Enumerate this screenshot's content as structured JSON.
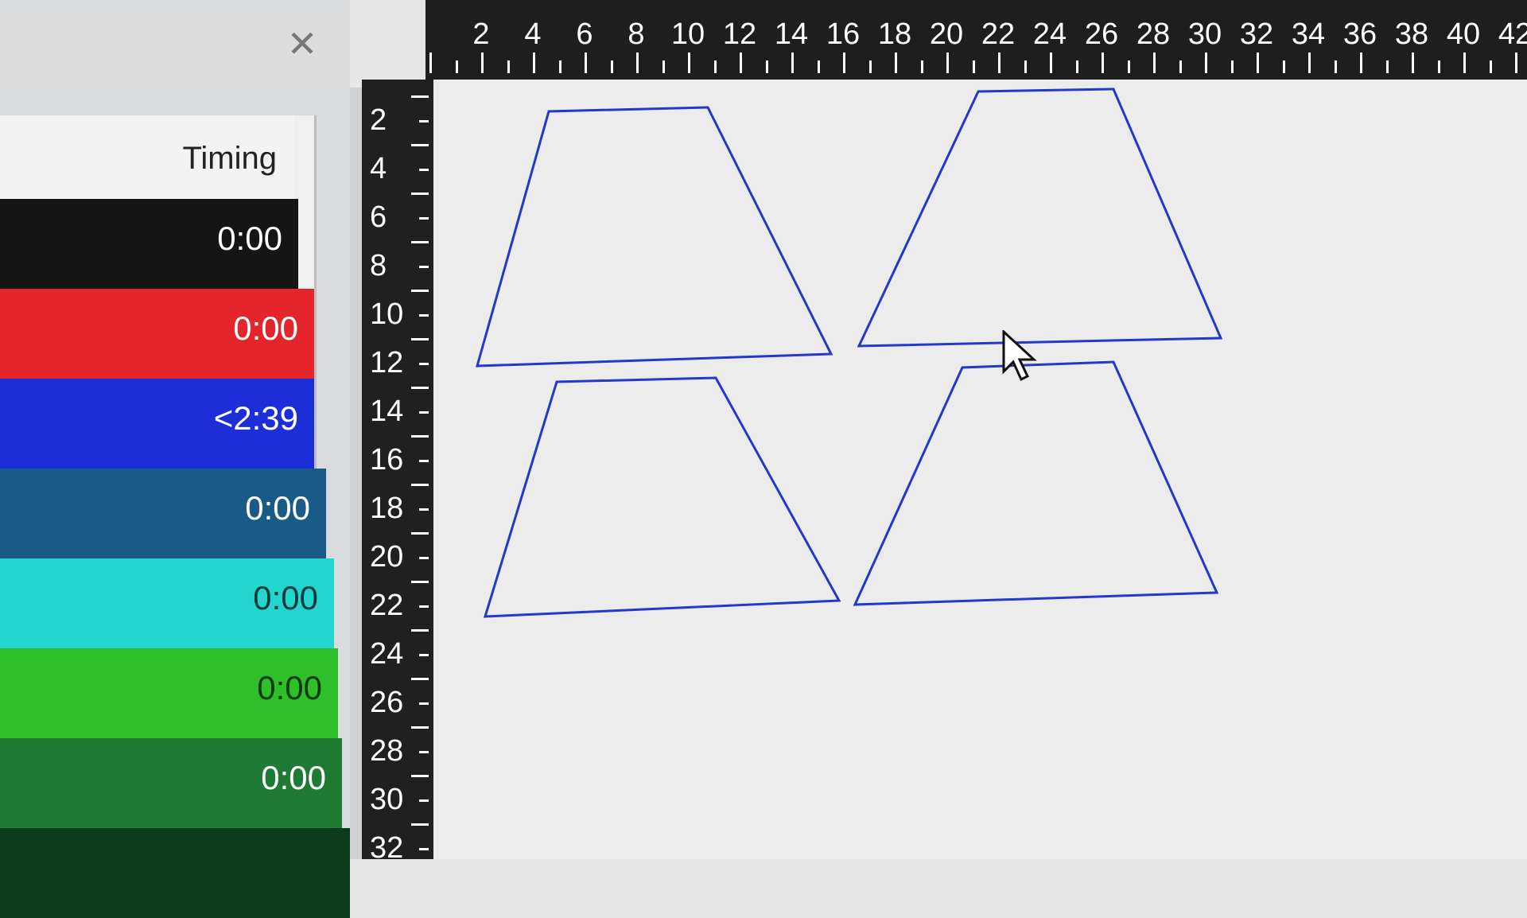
{
  "panel": {
    "close_icon": "close-icon",
    "timing_header": "Timing",
    "rows": [
      {
        "time": "0:00",
        "color": "#151515",
        "text_color": "#ffffff"
      },
      {
        "time": "0:00",
        "color": "#e4252b",
        "text_color": "#ffffff"
      },
      {
        "time": "<2:39",
        "color": "#1c2ed8",
        "text_color": "#ffffff"
      },
      {
        "time": "0:00",
        "color": "#1a5a86",
        "text_color": "#ffffff"
      },
      {
        "time": "0:00",
        "color": "#22d6cf",
        "text_color": "#0a3a3a"
      },
      {
        "time": "0:00",
        "color": "#2fbf2a",
        "text_color": "#0b3a0b"
      },
      {
        "time": "0:00",
        "color": "#1f7a33",
        "text_color": "#ffffff"
      },
      {
        "time": "",
        "color": "#0b3b1c",
        "text_color": "#ffffff"
      }
    ]
  },
  "top_ruler": [
    "2",
    "4",
    "6",
    "8",
    "10",
    "12",
    "14",
    "16",
    "18",
    "20",
    "22",
    "24",
    "26",
    "28",
    "30",
    "32",
    "34",
    "36",
    "38",
    "40",
    "42"
  ],
  "left_ruler": [
    "2",
    "4",
    "6",
    "8",
    "10",
    "12",
    "14",
    "16",
    "18",
    "20",
    "22",
    "24",
    "26",
    "28",
    "30",
    "32"
  ],
  "canvas": {
    "shape_color": "#2438c9"
  }
}
